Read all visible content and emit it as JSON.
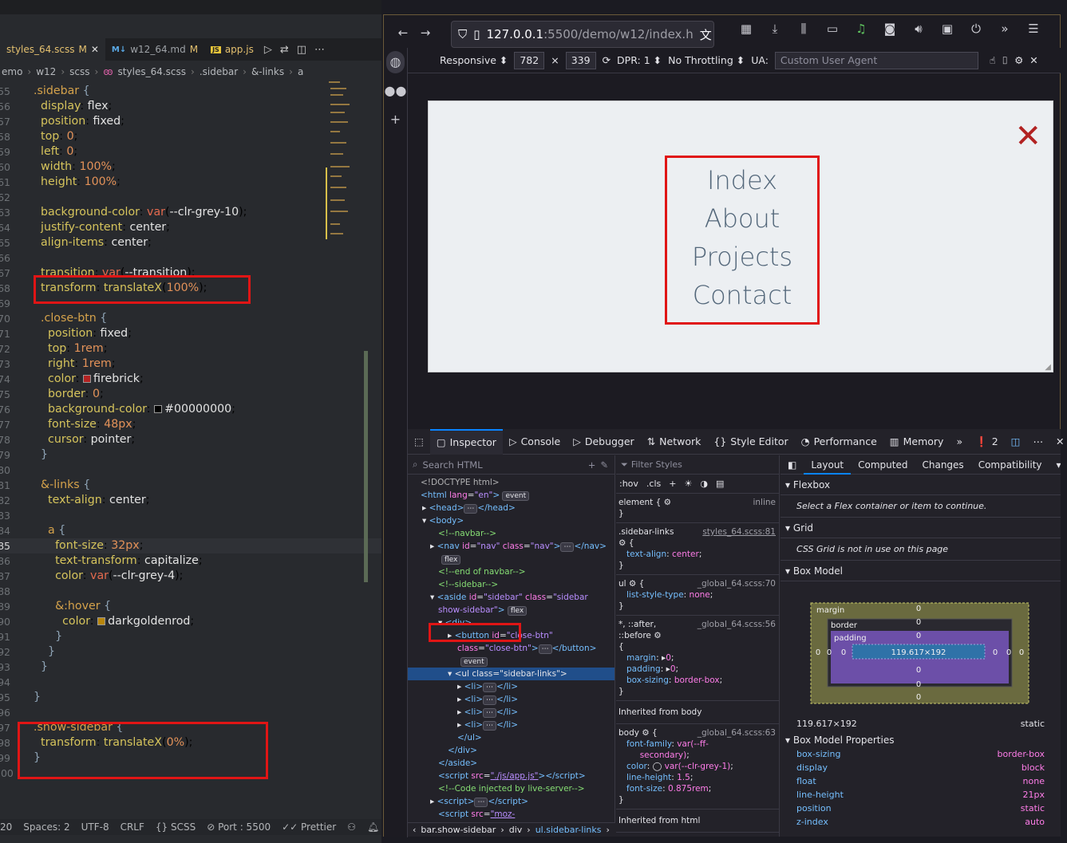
{
  "vscode": {
    "tabs": [
      {
        "label": "styles_64.scss",
        "mod": "M",
        "active": true
      },
      {
        "label": "w12_64.md",
        "mod": "M",
        "tag": "M↓"
      },
      {
        "label": "app.js",
        "tag": "JS"
      }
    ],
    "breadcrumb": [
      "emo",
      "w12",
      "scss",
      "styles_64.scss",
      ".sidebar",
      "&-links",
      "a"
    ],
    "status": {
      "line": "20",
      "spaces": "Spaces: 2",
      "encoding": "UTF-8",
      "eol": "CRLF",
      "lang": "SCSS",
      "port": "Port : 5500",
      "prettier": "Prettier"
    }
  },
  "firefox": {
    "url_main": "127.0.0.1",
    "url_rest": ":5500/demo/w12/index.h",
    "rdm": {
      "device": "Responsive",
      "width": "782",
      "x": "×",
      "height": "339",
      "dpr": "DPR: 1",
      "throttle": "No Throttling",
      "ua_label": "UA:",
      "ua_placeholder": "Custom User Agent"
    },
    "page": {
      "close": "✕",
      "links": [
        "Index",
        "About",
        "Projects",
        "Contact"
      ]
    },
    "devtools": {
      "tabs": [
        "Inspector",
        "Console",
        "Debugger",
        "Network",
        "Style Editor",
        "Performance",
        "Memory"
      ],
      "errors": "2",
      "search_placeholder": "Search HTML",
      "filter_placeholder": "Filter Styles",
      "layout_tabs": [
        "Layout",
        "Computed",
        "Changes",
        "Compatibility"
      ],
      "flexbox": {
        "title": "Flexbox",
        "note": "Select a Flex container or item to continue."
      },
      "grid": {
        "title": "Grid",
        "note": "CSS Grid is not in use on this page"
      },
      "boxmodel": {
        "title": "Box Model",
        "size": "119.617×192",
        "position": "static",
        "margin": "margin",
        "border": "border",
        "padding": "padding",
        "content": "119.617×192",
        "zero": "0"
      },
      "props_title": "Box Model Properties",
      "props": [
        [
          "box-sizing",
          "border-box"
        ],
        [
          "display",
          "block"
        ],
        [
          "float",
          "none"
        ],
        [
          "line-height",
          "21px"
        ],
        [
          "position",
          "static"
        ],
        [
          "z-index",
          "auto"
        ]
      ],
      "breadcrumb": [
        "bar.show-sidebar",
        "div",
        "ul.sidebar-links"
      ]
    }
  }
}
